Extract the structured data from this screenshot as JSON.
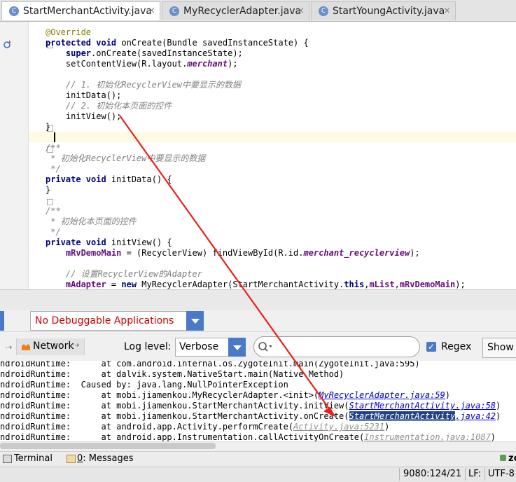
{
  "tabs": [
    {
      "label": "StartMerchantActivity.java",
      "close": "×",
      "icon": "C"
    },
    {
      "label": "MyRecyclerAdapter.java",
      "close": "×",
      "icon": "C"
    },
    {
      "label": "StartYoungActivity.java",
      "close": "×",
      "icon": "C"
    }
  ],
  "code": {
    "l01": "@Override",
    "l02a": "protected void",
    "l02b": " onCreate(Bundle savedInstanceState) {",
    "l03a": "    super",
    "l03b": ".onCreate(savedInstanceState);",
    "l04a": "    setContentView(R.layout.",
    "l04b": "merchant",
    "l04c": ");",
    "l05": "    // 1. 初始化RecyclerView中要显示的数据",
    "l06": "    initData();",
    "l07": "    // 2. 初始化本页面的控件",
    "l08": "    initView();",
    "l09": "}",
    "l10": "/**",
    "l11": " * 初始化RecyclerView中要显示的数据",
    "l12": " */",
    "l13a": "private void",
    "l13b": " initData() {",
    "l14": "}",
    "l15": "/**",
    "l16": " * 初始化本页面的控件",
    "l17": " */",
    "l18a": "private void",
    "l18b": " initView() {",
    "l19a": "    mRvDemoMain",
    "l19b": " = (RecyclerView) findViewById(R.id.",
    "l19c": "merchant_recyclerview",
    "l19d": ");",
    "l20": "    // 设置RecyclerView的Adapter",
    "l21a": "    mAdapter",
    "l21b": " = ",
    "l21c": "new",
    "l21d": " MyRecyclerAdapter(StartMerchantActivity.",
    "l21e": "this",
    "l21f": ",",
    "l21g": "mList",
    "l21h": ",",
    "l21i": "mRvDemoMain",
    "l21j": ");"
  },
  "logcat": {
    "app_filter": "No Debuggable Applications",
    "network_label": "Network",
    "log_level_label": "Log level:",
    "log_level_value": "Verbose",
    "regex_label": "Regex",
    "regex_checked": true,
    "show_label": "Show",
    "lines": {
      "r1": "ndroidRuntime:      at com.android.internal.os.ZygoteInit.main(ZygoteInit.java:595)",
      "r2": "ndroidRuntime:      at dalvik.system.NativeStart.main(Native Method)",
      "r3": "ndroidRuntime:  Caused by: java.lang.NullPointerException",
      "r4a": "ndroidRuntime:      at mobi.jiamenkou.MyRecyclerAdapter.<init>(",
      "r4b": "MyRecyclerAdapter.java:59",
      "r4c": ")",
      "r5a": "ndroidRuntime:      at mobi.jiamenkou.StartMerchantActivity.initView(",
      "r5b": "StartMerchantActivity.java:58",
      "r5c": ")",
      "r6a": "ndroidRuntime:      at mobi.jiamenkou.StartMerchantActivity.onCreate(",
      "r6b": "StartMerchantActivity",
      "r6c": ".java:42",
      "r6d": ")",
      "r7a": "ndroidRuntime:      at android.app.Activity.performCreate(",
      "r7b": "Activity.java:5231",
      "r7c": ")",
      "r8a": "ndroidRuntime:      at android.app.Instrumentation.callActivityOnCreate(",
      "r8b": "Instrumentation.java:1087",
      "r8c": ")"
    }
  },
  "bottom_tools": {
    "terminal": "Terminal",
    "messages_num": "0",
    "messages_rest": ": Messages",
    "right_label": "zo"
  },
  "status": {
    "position": "9080:124/21",
    "line_sep": "LF:",
    "encoding": "UTF-8"
  },
  "colors": {
    "arrow": "#e8211b",
    "selection": "#214283",
    "accent": "#4a7ac7"
  }
}
